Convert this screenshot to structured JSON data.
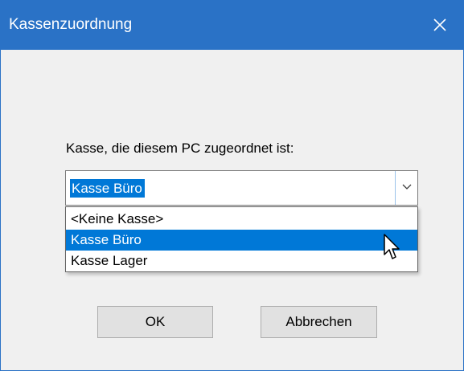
{
  "window": {
    "title": "Kassenzuordnung",
    "close_icon": "close-icon"
  },
  "form": {
    "label": "Kasse, die diesem PC zugeordnet ist:",
    "combo": {
      "selected_value": "Kasse Büro",
      "arrow_icon": "chevron-down-icon",
      "options": [
        {
          "label": "<Keine Kasse>",
          "selected": false
        },
        {
          "label": "Kasse Büro",
          "selected": true
        },
        {
          "label": "Kasse Lager",
          "selected": false
        }
      ]
    }
  },
  "buttons": {
    "ok_label": "OK",
    "cancel_label": "Abbrechen"
  },
  "colors": {
    "titlebar": "#2a72c6",
    "selection": "#0078d7",
    "dialog_bg": "#f0f0f0"
  },
  "pointer_icon": "mouse-pointer-icon"
}
